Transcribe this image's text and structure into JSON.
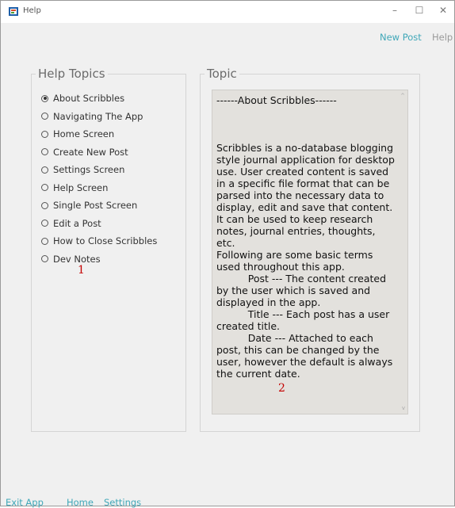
{
  "window": {
    "title": "Help",
    "minimize_glyph": "–",
    "maximize_glyph": "☐",
    "close_glyph": "✕"
  },
  "menu": {
    "new_post": "New Post",
    "help": "Help"
  },
  "help_topics": {
    "legend": "Help Topics",
    "items": [
      {
        "label": "About Scribbles",
        "checked": true
      },
      {
        "label": "Navigating The App",
        "checked": false
      },
      {
        "label": "Home Screen",
        "checked": false
      },
      {
        "label": "Create New Post",
        "checked": false
      },
      {
        "label": "Settings Screen",
        "checked": false
      },
      {
        "label": "Help Screen",
        "checked": false
      },
      {
        "label": "Single Post Screen",
        "checked": false
      },
      {
        "label": "Edit a Post",
        "checked": false
      },
      {
        "label": "How to Close Scribbles",
        "checked": false
      },
      {
        "label": "Dev Notes",
        "checked": false
      }
    ],
    "annotation": "1"
  },
  "topic": {
    "legend": "Topic",
    "content": "------About Scribbles------\n\n\n\nScribbles is a no-database blogging style journal application for desktop use. User created content is saved in a specific file format that can be parsed into the necessary data to display, edit and save that content. It can be used to keep research notes, journal entries, thoughts, etc.\nFollowing are some basic terms used throughout this app.\n          Post --- The content created by the user which is saved and displayed in the app.\n          Title --- Each post has a user created title.\n          Date --- Attached to each post, this can be changed by the user, however the default is always the current date.",
    "annotation": "2",
    "scroll_up_glyph": "^",
    "scroll_down_glyph": "v"
  },
  "footer": {
    "exit_app": "Exit App",
    "home": "Home",
    "settings": "Settings"
  },
  "colors": {
    "link": "#3fa7b8",
    "annotation": "#c40000",
    "window_bg": "#f0f0f0",
    "textarea_bg": "#e3e1dd"
  }
}
